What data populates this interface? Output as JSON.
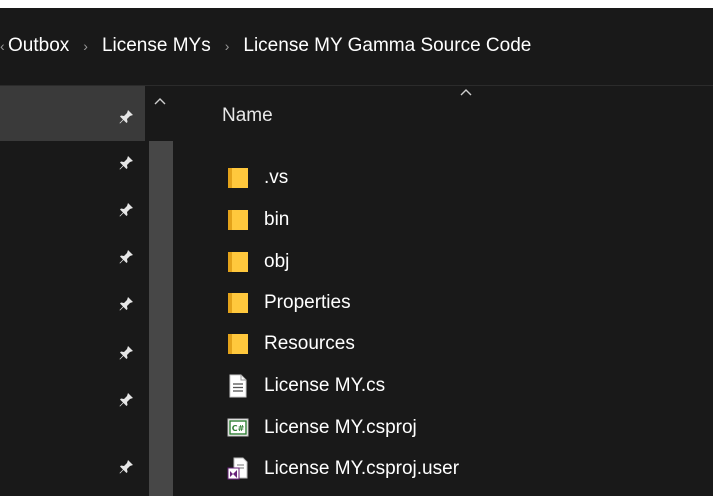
{
  "breadcrumb": {
    "items": [
      "Outbox",
      "License MYs",
      "License MY Gamma Source Code"
    ],
    "separator": "›"
  },
  "columns": {
    "name_label": "Name"
  },
  "files": [
    {
      "name": ".vs",
      "icon": "folder-icon"
    },
    {
      "name": "bin",
      "icon": "folder-icon"
    },
    {
      "name": "obj",
      "icon": "folder-icon"
    },
    {
      "name": "Properties",
      "icon": "folder-icon"
    },
    {
      "name": "Resources",
      "icon": "folder-icon"
    },
    {
      "name": "License MY.cs",
      "icon": "text-document-icon"
    },
    {
      "name": "License MY.csproj",
      "icon": "csharp-project-icon"
    },
    {
      "name": "License MY.csproj.user",
      "icon": "visual-studio-user-file-icon"
    }
  ],
  "colors": {
    "background": "#191919",
    "folder": "#ffc83d",
    "selected_nav": "#3a3a3a",
    "scroll_track": "#474747",
    "csharp_green": "#2e7d32",
    "vs_purple": "#68217a"
  }
}
